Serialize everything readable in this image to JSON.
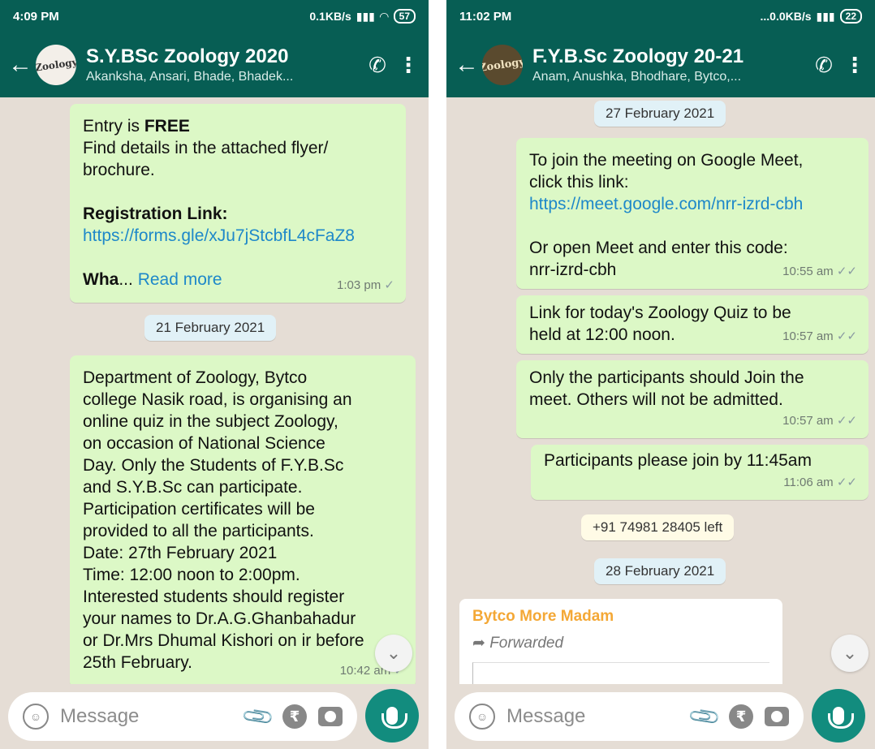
{
  "left": {
    "status": {
      "time": "4:09 PM",
      "net": "0.1KB/s",
      "battery": "57"
    },
    "header": {
      "title": "S.Y.BSc Zoology 2020",
      "subtitle": "Akanksha, Ansari, Bhade, Bhadek...",
      "avatar_text": "Zoology"
    },
    "msg1": {
      "line1_pre": "Entry is ",
      "line1_bold": "FREE",
      "line2": "Find details in the attached flyer/",
      "line3": "brochure.",
      "reg_label": "Registration Link:",
      "reg_link": "https://forms.gle/xJu7jStcbfL4cFaZ8",
      "trunc_bold": "Wha",
      "ellipsis": "...",
      "read_more": "Read more",
      "time": "1:03 pm"
    },
    "date1": "21 February 2021",
    "msg2": {
      "lines": [
        "Department of Zoology, Bytco",
        "college Nasik road, is organising an",
        "online quiz in the subject Zoology,",
        "on occasion of National Science",
        "Day. Only the  Students of F.Y.B.Sc",
        "and S.Y.B.Sc can participate.",
        "Participation certificates will be",
        "provided to all the participants.",
        "Date: 27th February 2021",
        "Time: 12:00 noon to 2:00pm.",
        "Interested students should register",
        "your names to Dr.A.G.Ghanbahadur",
        "or Dr.Mrs Dhumal Kishori on ir before",
        "25th February."
      ],
      "time": "10:42 am"
    },
    "input_placeholder": "Message"
  },
  "right": {
    "status": {
      "time": "11:02 PM",
      "net": "...0.0KB/s",
      "battery": "22"
    },
    "header": {
      "title": "F.Y.B.Sc Zoology 20-21",
      "subtitle": "Anam, Anushka, Bhodhare, Bytco,...",
      "avatar_text": "Zoology"
    },
    "date1": "27 February 2021",
    "msg1": {
      "line1": "To join the meeting on Google Meet,",
      "line2": "click this link:",
      "link": "https://meet.google.com/nrr-izrd-cbh",
      "line3": "Or open Meet and enter this code:",
      "line4": "nrr-izrd-cbh",
      "time": "10:55 am"
    },
    "msg2": {
      "line1": "Link for today's Zoology Quiz to be",
      "line2": "held at 12:00 noon.",
      "time": "10:57 am"
    },
    "msg3": {
      "line1": "Only the participants should Join the",
      "line2": "meet. Others will not be admitted.",
      "time": "10:57 am"
    },
    "msg4": {
      "line1": "Participants please join by 11:45am",
      "time": "11:06 am"
    },
    "system": "+91 74981 28405 left",
    "date2": "28 February 2021",
    "msg5": {
      "sender": "Bytco More Madam",
      "forwarded": "Forwarded"
    },
    "input_placeholder": "Message"
  },
  "icons": {
    "back": "back-arrow-icon",
    "call": "add-call-icon",
    "menu": "more-vert-icon",
    "emoji": "emoji-icon",
    "attach": "attach-icon",
    "rupee": "rupee-icon",
    "camera": "camera-icon",
    "mic": "mic-icon",
    "read_tick": "double-tick-icon",
    "sent_tick": "single-tick-icon"
  },
  "colors": {
    "header": "#075e54",
    "outgoing": "#dcf8c6",
    "mic": "#128c7e",
    "link": "#1e88c9",
    "sender": "#f4a836"
  }
}
